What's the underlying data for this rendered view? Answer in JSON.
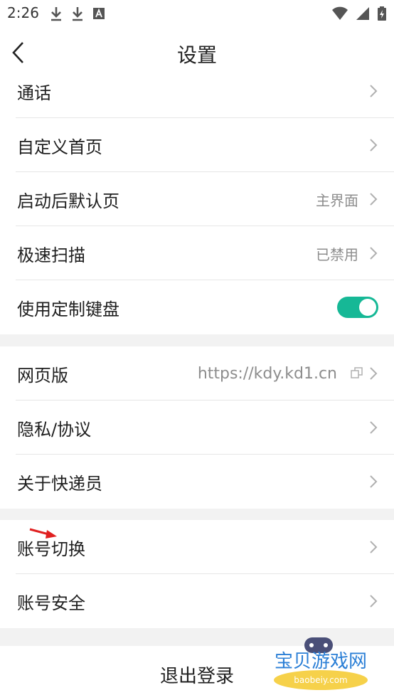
{
  "status_bar": {
    "time": "2:26",
    "left_icons": [
      "download-icon",
      "download-icon",
      "text-a-icon"
    ],
    "right_icons": [
      "wifi-icon",
      "signal-icon",
      "battery-charging-icon"
    ]
  },
  "nav": {
    "title": "设置"
  },
  "group1": [
    {
      "label": "通话",
      "value": ""
    },
    {
      "label": "自定义首页",
      "value": ""
    },
    {
      "label": "启动后默认页",
      "value": "主界面"
    },
    {
      "label": "极速扫描",
      "value": "已禁用"
    },
    {
      "label": "使用定制键盘",
      "toggle": "on"
    }
  ],
  "group2": [
    {
      "label": "网页版",
      "value": "https://kdy.kd1.cn",
      "icon": "copy-icon"
    },
    {
      "label": "隐私/协议",
      "value": ""
    },
    {
      "label": "关于快递员",
      "value": ""
    }
  ],
  "group3": [
    {
      "label": "账号切换",
      "value": ""
    },
    {
      "label": "账号安全",
      "value": ""
    }
  ],
  "logout_label": "退出登录",
  "watermark": {
    "title": "宝贝游戏网",
    "domain": "baobeiy.com"
  },
  "colors": {
    "accent": "#16b896",
    "annotation_arrow": "#e02020"
  }
}
